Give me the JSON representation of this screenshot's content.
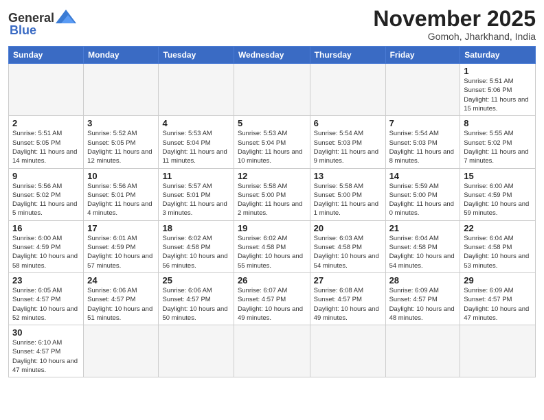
{
  "header": {
    "logo_general": "General",
    "logo_blue": "Blue",
    "month_title": "November 2025",
    "location": "Gomoh, Jharkhand, India"
  },
  "days_of_week": [
    "Sunday",
    "Monday",
    "Tuesday",
    "Wednesday",
    "Thursday",
    "Friday",
    "Saturday"
  ],
  "weeks": [
    [
      {
        "day": "",
        "info": ""
      },
      {
        "day": "",
        "info": ""
      },
      {
        "day": "",
        "info": ""
      },
      {
        "day": "",
        "info": ""
      },
      {
        "day": "",
        "info": ""
      },
      {
        "day": "",
        "info": ""
      },
      {
        "day": "1",
        "info": "Sunrise: 5:51 AM\nSunset: 5:06 PM\nDaylight: 11 hours and 15 minutes."
      }
    ],
    [
      {
        "day": "2",
        "info": "Sunrise: 5:51 AM\nSunset: 5:05 PM\nDaylight: 11 hours and 14 minutes."
      },
      {
        "day": "3",
        "info": "Sunrise: 5:52 AM\nSunset: 5:05 PM\nDaylight: 11 hours and 12 minutes."
      },
      {
        "day": "4",
        "info": "Sunrise: 5:53 AM\nSunset: 5:04 PM\nDaylight: 11 hours and 11 minutes."
      },
      {
        "day": "5",
        "info": "Sunrise: 5:53 AM\nSunset: 5:04 PM\nDaylight: 11 hours and 10 minutes."
      },
      {
        "day": "6",
        "info": "Sunrise: 5:54 AM\nSunset: 5:03 PM\nDaylight: 11 hours and 9 minutes."
      },
      {
        "day": "7",
        "info": "Sunrise: 5:54 AM\nSunset: 5:03 PM\nDaylight: 11 hours and 8 minutes."
      },
      {
        "day": "8",
        "info": "Sunrise: 5:55 AM\nSunset: 5:02 PM\nDaylight: 11 hours and 7 minutes."
      }
    ],
    [
      {
        "day": "9",
        "info": "Sunrise: 5:56 AM\nSunset: 5:02 PM\nDaylight: 11 hours and 5 minutes."
      },
      {
        "day": "10",
        "info": "Sunrise: 5:56 AM\nSunset: 5:01 PM\nDaylight: 11 hours and 4 minutes."
      },
      {
        "day": "11",
        "info": "Sunrise: 5:57 AM\nSunset: 5:01 PM\nDaylight: 11 hours and 3 minutes."
      },
      {
        "day": "12",
        "info": "Sunrise: 5:58 AM\nSunset: 5:00 PM\nDaylight: 11 hours and 2 minutes."
      },
      {
        "day": "13",
        "info": "Sunrise: 5:58 AM\nSunset: 5:00 PM\nDaylight: 11 hours and 1 minute."
      },
      {
        "day": "14",
        "info": "Sunrise: 5:59 AM\nSunset: 5:00 PM\nDaylight: 11 hours and 0 minutes."
      },
      {
        "day": "15",
        "info": "Sunrise: 6:00 AM\nSunset: 4:59 PM\nDaylight: 10 hours and 59 minutes."
      }
    ],
    [
      {
        "day": "16",
        "info": "Sunrise: 6:00 AM\nSunset: 4:59 PM\nDaylight: 10 hours and 58 minutes."
      },
      {
        "day": "17",
        "info": "Sunrise: 6:01 AM\nSunset: 4:59 PM\nDaylight: 10 hours and 57 minutes."
      },
      {
        "day": "18",
        "info": "Sunrise: 6:02 AM\nSunset: 4:58 PM\nDaylight: 10 hours and 56 minutes."
      },
      {
        "day": "19",
        "info": "Sunrise: 6:02 AM\nSunset: 4:58 PM\nDaylight: 10 hours and 55 minutes."
      },
      {
        "day": "20",
        "info": "Sunrise: 6:03 AM\nSunset: 4:58 PM\nDaylight: 10 hours and 54 minutes."
      },
      {
        "day": "21",
        "info": "Sunrise: 6:04 AM\nSunset: 4:58 PM\nDaylight: 10 hours and 54 minutes."
      },
      {
        "day": "22",
        "info": "Sunrise: 6:04 AM\nSunset: 4:58 PM\nDaylight: 10 hours and 53 minutes."
      }
    ],
    [
      {
        "day": "23",
        "info": "Sunrise: 6:05 AM\nSunset: 4:57 PM\nDaylight: 10 hours and 52 minutes."
      },
      {
        "day": "24",
        "info": "Sunrise: 6:06 AM\nSunset: 4:57 PM\nDaylight: 10 hours and 51 minutes."
      },
      {
        "day": "25",
        "info": "Sunrise: 6:06 AM\nSunset: 4:57 PM\nDaylight: 10 hours and 50 minutes."
      },
      {
        "day": "26",
        "info": "Sunrise: 6:07 AM\nSunset: 4:57 PM\nDaylight: 10 hours and 49 minutes."
      },
      {
        "day": "27",
        "info": "Sunrise: 6:08 AM\nSunset: 4:57 PM\nDaylight: 10 hours and 49 minutes."
      },
      {
        "day": "28",
        "info": "Sunrise: 6:09 AM\nSunset: 4:57 PM\nDaylight: 10 hours and 48 minutes."
      },
      {
        "day": "29",
        "info": "Sunrise: 6:09 AM\nSunset: 4:57 PM\nDaylight: 10 hours and 47 minutes."
      }
    ],
    [
      {
        "day": "30",
        "info": "Sunrise: 6:10 AM\nSunset: 4:57 PM\nDaylight: 10 hours and 47 minutes."
      },
      {
        "day": "",
        "info": ""
      },
      {
        "day": "",
        "info": ""
      },
      {
        "day": "",
        "info": ""
      },
      {
        "day": "",
        "info": ""
      },
      {
        "day": "",
        "info": ""
      },
      {
        "day": "",
        "info": ""
      }
    ]
  ]
}
